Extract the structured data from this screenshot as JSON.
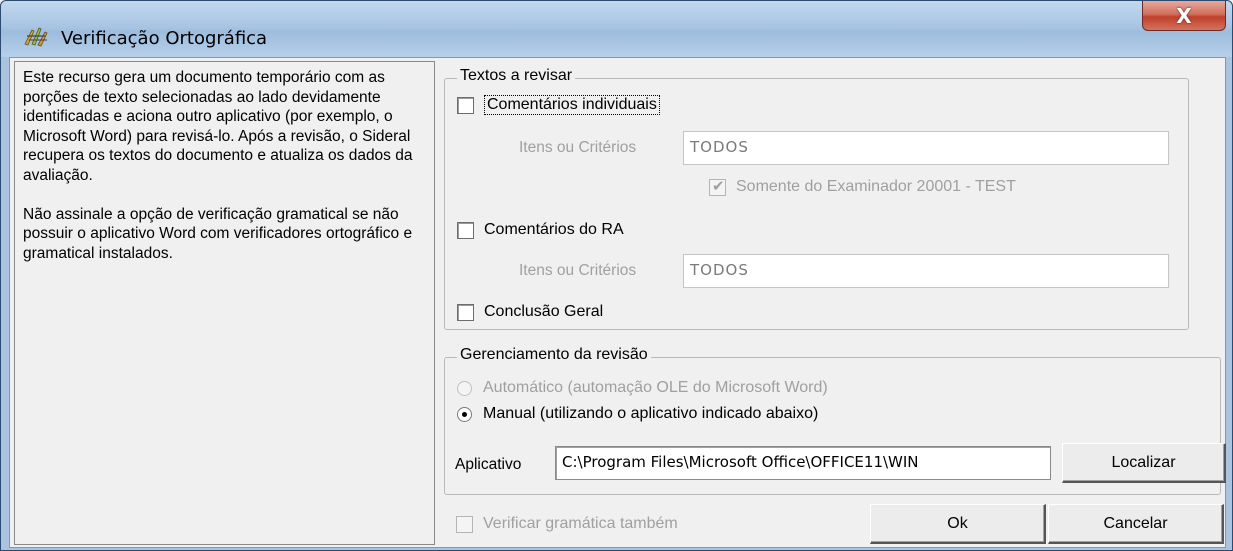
{
  "window": {
    "title": "Verificação Ortográfica",
    "close_label": "X"
  },
  "info": {
    "paragraph1": "Este recurso gera um documento temporário com as porções de texto selecionadas ao lado devidamente identificadas e aciona outro aplicativo (por exemplo, o Microsoft Word) para revisá-lo. Após a revisão, o Sideral recupera os textos do documento e atualiza os dados da avaliação.",
    "paragraph2": "Não assinale a opção de verificação gramatical se não possuir o aplicativo Word com verificadores ortográfico e gramatical instalados."
  },
  "textos": {
    "legend": "Textos a revisar",
    "comentarios_individuais": {
      "label": "Comentários individuais",
      "checked": false
    },
    "itens_label_1": "Itens ou Critérios",
    "itens_value_1": "TODOS",
    "somente_examinador": {
      "label": "Somente do Examinador 20001 - TEST",
      "checked": true,
      "disabled": true
    },
    "comentarios_ra": {
      "label": "Comentários do RA",
      "checked": false
    },
    "itens_label_2": "Itens ou Critérios",
    "itens_value_2": "TODOS",
    "conclusao_geral": {
      "label": "Conclusão Geral",
      "checked": false
    }
  },
  "gerenciamento": {
    "legend": "Gerenciamento da revisão",
    "automatico": {
      "label": "Automático (automação OLE do Microsoft Word)",
      "selected": false,
      "disabled": true
    },
    "manual": {
      "label": "Manual (utilizando o aplicativo indicado abaixo)",
      "selected": true
    },
    "aplicativo_label": "Aplicativo",
    "aplicativo_value": "C:\\Program Files\\Microsoft Office\\OFFICE11\\WIN",
    "localizar_label": "Localizar"
  },
  "footer": {
    "verificar_gramatica": {
      "label": "Verificar gramática também",
      "checked": false,
      "disabled": true
    },
    "ok_label": "Ok",
    "cancelar_label": "Cancelar"
  }
}
